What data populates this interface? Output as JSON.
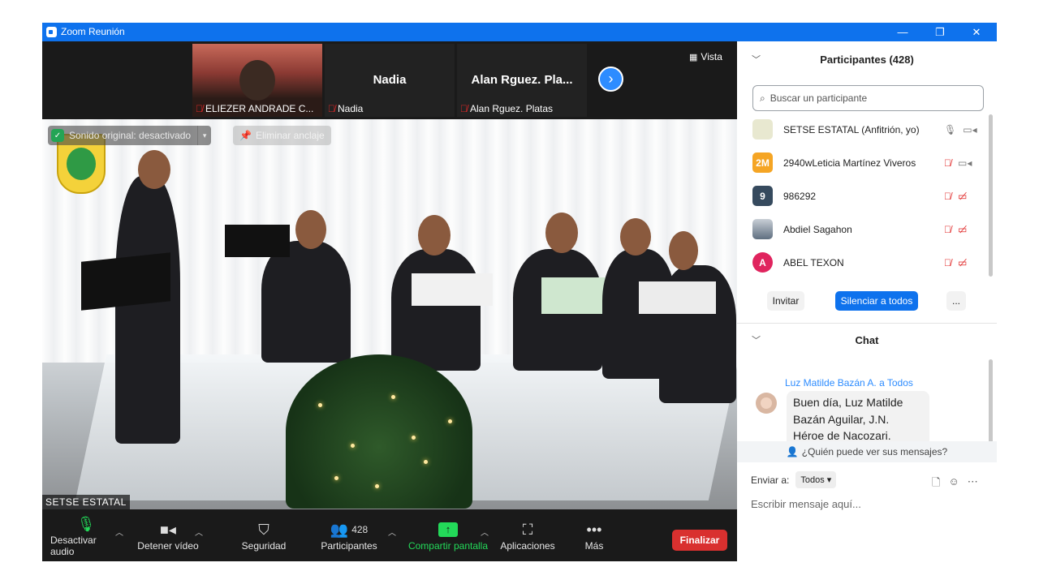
{
  "window": {
    "title": "Zoom Reunión",
    "min": "—",
    "restore": "❐",
    "close": "✕"
  },
  "strip": {
    "thumbs": [
      {
        "caption": "ELIEZER ANDRADE C...",
        "big": ""
      },
      {
        "caption": "Nadia",
        "big": "Nadia"
      },
      {
        "caption": "Alan  Rguez. Platas",
        "big": "Alan  Rguez. Pla..."
      }
    ],
    "vista": "Vista",
    "next": "›"
  },
  "main": {
    "original_sound": "Sonido original: desactivado",
    "unpin": "Eliminar anclaje",
    "speaker_name": "SETSE ESTATAL"
  },
  "toolbar": {
    "mute": "Desactivar audio",
    "stop_video": "Detener vídeo",
    "security": "Seguridad",
    "participants": "Participantes",
    "participants_count": "428",
    "share": "Compartir pantalla",
    "apps": "Aplicaciones",
    "more": "Más",
    "end": "Finalizar"
  },
  "participants": {
    "header": "Participantes (428)",
    "search_placeholder": "Buscar un participante",
    "list": [
      {
        "initials": "",
        "name": "SETSE ESTATAL (Anfitrión, yo)",
        "color": "#e8e8d0"
      },
      {
        "initials": "2M",
        "name": "2940wLeticia Martínez Viveros",
        "color": "#f5a524"
      },
      {
        "initials": "9",
        "name": "986292",
        "color": "#364a5e"
      },
      {
        "initials": "",
        "name": "Abdiel Sagahon",
        "color": "#c9cfd6"
      },
      {
        "initials": "A",
        "name": "ABEL TEXON",
        "color": "#e0245e"
      }
    ],
    "invite": "Invitar",
    "mute_all": "Silenciar a todos",
    "more": "..."
  },
  "chat": {
    "header": "Chat",
    "sender": "Luz Matilde Bazán A. a Todos",
    "message": "Buen día, Luz Matilde Bazán Aguilar, J.N. Héroe de Nacozari.",
    "who_sees": "¿Quién puede ver sus mensajes?",
    "send_to_label": "Enviar a:",
    "send_to_value": "Todos",
    "input_placeholder": "Escribir mensaje aquí..."
  },
  "colors": {
    "accent": "#0e72ed",
    "end": "#d9302f",
    "share": "#23d959"
  }
}
